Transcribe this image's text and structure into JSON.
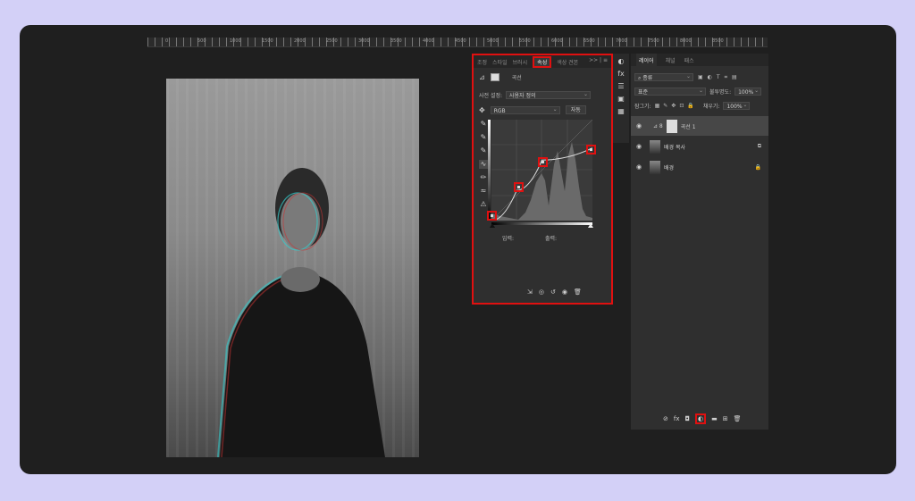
{
  "ruler": {
    "ticks": [
      "0",
      "500",
      "1000",
      "1500",
      "2000",
      "2500",
      "3000",
      "3500",
      "4000",
      "4500",
      "5000",
      "5500",
      "6000",
      "6500",
      "7000",
      "7500",
      "8000",
      "8500"
    ]
  },
  "properties": {
    "tabs": [
      "조정",
      "스타일",
      "브러시",
      "속성",
      "색상 견본"
    ],
    "active_tab": "속성",
    "more": ">> | ≡",
    "layer_type_label": "곡선",
    "preset_label": "사전 설정:",
    "preset_value": "사용자 정의",
    "channel_value": "RGB",
    "auto_button": "자동",
    "input_label": "입력:",
    "output_label": "출력:",
    "curve_points": [
      [
        0,
        0
      ],
      [
        0.25,
        0.3
      ],
      [
        0.5,
        0.6
      ],
      [
        1,
        0.72
      ]
    ]
  },
  "layers": {
    "tabs": [
      "레이어",
      "채널",
      "패스"
    ],
    "active_tab": "레이어",
    "kind_filter": "종류",
    "blend_mode": "표준",
    "opacity_label": "불투명도:",
    "opacity_value": "100%",
    "lock_label": "잠그기:",
    "fill_label": "채우기:",
    "fill_value": "100%",
    "items": [
      {
        "name": "곡선 1"
      },
      {
        "name": "배경 복사"
      },
      {
        "name": "배경"
      }
    ]
  },
  "colors": {
    "highlight": "#e01010",
    "panel": "#2f2f2f",
    "background": "#d3d0f7"
  }
}
